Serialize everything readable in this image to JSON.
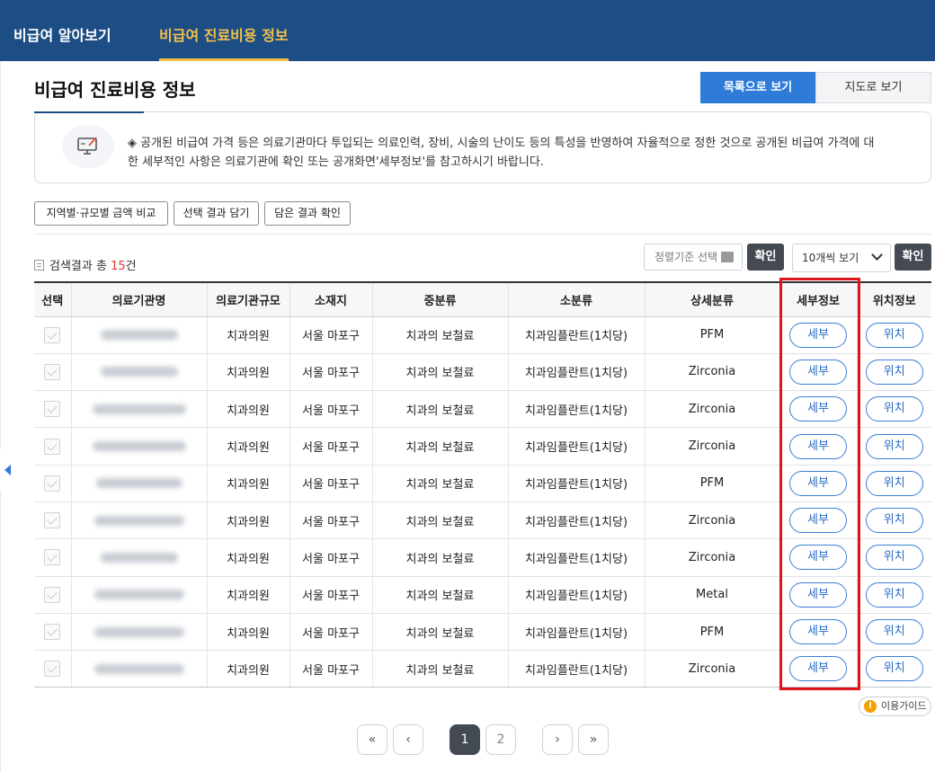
{
  "nav": {
    "tab1": "비급여 알아보기",
    "tab2": "비급여 진료비용 정보",
    "active_color": "#f5c04a",
    "bg_color": "#1c4d85"
  },
  "page_title": "비급여 진료비용 정보",
  "view_toggle": {
    "list": "목록으로 보기",
    "map": "지도로 보기"
  },
  "notice": {
    "icon": "computer-pen-icon",
    "line1": "◈ 공개된 비급여 가격 등은 의료기관마다 투입되는 의료인력, 장비, 시술의 난이도 등의 특성을 반영하여 자율적으로 정한 것으로 공개된 비급여 가격에 대",
    "line2": "한 세부적인 사항은 의료기관에 확인 또는 공개화면'세부정보'를 참고하시기 바랍니다."
  },
  "actions": {
    "compare": "지역별·규모별 금액 비교",
    "save": "선택 결과 담기",
    "view_saved": "담은 결과 확인"
  },
  "result": {
    "prefix": "검색결과 총",
    "count": "15",
    "suffix": "건"
  },
  "sort": {
    "placeholder": "정렬기준 선택",
    "confirm": "확인"
  },
  "per_page": {
    "selected": "10개씩 보기",
    "confirm": "확인"
  },
  "table": {
    "headers": [
      "선택",
      "의료기관명",
      "의료기관규모",
      "소재지",
      "중분류",
      "소분류",
      "상세분류",
      "세부정보",
      "위치정보"
    ],
    "detail_label": "세부",
    "location_label": "위치",
    "rows": [
      {
        "size": "치과의원",
        "location": "서울 마포구",
        "mid": "치과의 보철료",
        "sub": "치과임플란트(1치당)",
        "detail": "PFM"
      },
      {
        "size": "치과의원",
        "location": "서울 마포구",
        "mid": "치과의 보철료",
        "sub": "치과임플란트(1치당)",
        "detail": "Zirconia"
      },
      {
        "size": "치과의원",
        "location": "서울 마포구",
        "mid": "치과의 보철료",
        "sub": "치과임플란트(1치당)",
        "detail": "Zirconia"
      },
      {
        "size": "치과의원",
        "location": "서울 마포구",
        "mid": "치과의 보철료",
        "sub": "치과임플란트(1치당)",
        "detail": "Zirconia"
      },
      {
        "size": "치과의원",
        "location": "서울 마포구",
        "mid": "치과의 보철료",
        "sub": "치과임플란트(1치당)",
        "detail": "PFM"
      },
      {
        "size": "치과의원",
        "location": "서울 마포구",
        "mid": "치과의 보철료",
        "sub": "치과임플란트(1치당)",
        "detail": "Zirconia"
      },
      {
        "size": "치과의원",
        "location": "서울 마포구",
        "mid": "치과의 보철료",
        "sub": "치과임플란트(1치당)",
        "detail": "Zirconia"
      },
      {
        "size": "치과의원",
        "location": "서울 마포구",
        "mid": "치과의 보철료",
        "sub": "치과임플란트(1치당)",
        "detail": "Metal"
      },
      {
        "size": "치과의원",
        "location": "서울 마포구",
        "mid": "치과의 보철료",
        "sub": "치과임플란트(1치당)",
        "detail": "PFM"
      },
      {
        "size": "치과의원",
        "location": "서울 마포구",
        "mid": "치과의 보철료",
        "sub": "치과임플란트(1치당)",
        "detail": "Zirconia"
      }
    ]
  },
  "guide": {
    "icon": "exclamation-icon",
    "label": "이용가이드"
  },
  "pagination": {
    "first": "«",
    "prev": "‹",
    "pages": [
      "1",
      "2"
    ],
    "current": "1",
    "next": "›",
    "last": "»"
  },
  "accent_color": "#2e7bd8",
  "highlight_color": "#e0141b"
}
